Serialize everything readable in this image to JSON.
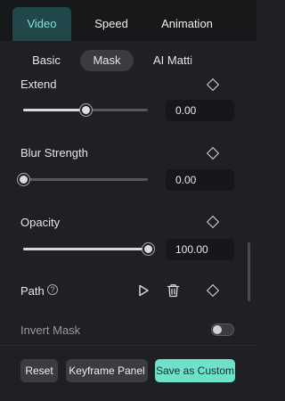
{
  "tabs": [
    {
      "label": "Video",
      "active": true
    },
    {
      "label": "Speed",
      "active": false
    },
    {
      "label": "Animation",
      "active": false
    }
  ],
  "subtabs": [
    {
      "label": "Basic",
      "active": false
    },
    {
      "label": "Mask",
      "active": true
    },
    {
      "label": "AI Matti",
      "active": false
    }
  ],
  "controls": {
    "extend": {
      "label": "Extend",
      "value": "0.00",
      "slider_level": 0.5
    },
    "blur": {
      "label": "Blur Strength",
      "value": "0.00",
      "slider_level": 0.0
    },
    "opacity": {
      "label": "Opacity",
      "value": "100.00",
      "slider_level": 1.0
    }
  },
  "path": {
    "label": "Path",
    "help_glyph": "?",
    "play_icon": "play-icon",
    "delete_icon": "trash-icon",
    "keyframe_icon": "keyframe-diamond-icon"
  },
  "invert_mask": {
    "label": "Invert Mask",
    "enabled": false
  },
  "footer": {
    "reset": "Reset",
    "keyframe_panel": "Keyframe Panel",
    "save_custom": "Save as Custom"
  },
  "colors": {
    "accent": "#6fe1c9",
    "active_tab_bg": "#20484a",
    "panel_bg": "#1f2023"
  }
}
